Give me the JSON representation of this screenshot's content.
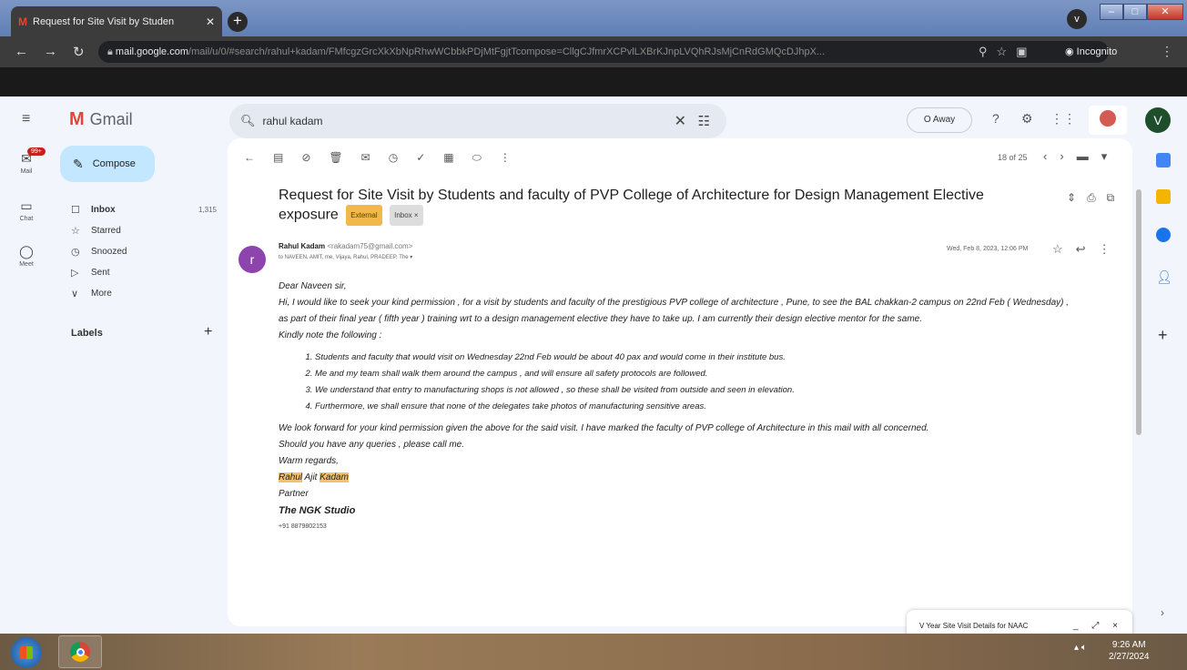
{
  "browser": {
    "tab_title": "Request for Site Visit by Studen",
    "tab_favicon": "gmail-icon",
    "url_host": "mail.google.com",
    "url_path": "/mail/u/0/#search/rahul+kadam/FMfcgzGrcXkXbNpRhwWCbbkPDjMtFgjtTcompose=CllgCJfmrXCPvlLXBrKJnpLVQhRJsMjCnRdGMQcDJhpX...",
    "incognito_label": "Incognito",
    "profile_menu_label": "v"
  },
  "gmail": {
    "app_name": "Gmail",
    "search_value": "rahul kadam",
    "status_label": "O Away",
    "avatar_letter": "V",
    "compose_label": "Compose",
    "nav": [
      {
        "icon": "inbox-icon",
        "glyph": "☐",
        "label": "Inbox",
        "count": "1,315"
      },
      {
        "icon": "star-icon",
        "glyph": "☆",
        "label": "Starred",
        "count": ""
      },
      {
        "icon": "clock-icon",
        "glyph": "◷",
        "label": "Snoozed",
        "count": ""
      },
      {
        "icon": "send-icon",
        "glyph": "▷",
        "label": "Sent",
        "count": ""
      },
      {
        "icon": "chevron-down-icon",
        "glyph": "∨",
        "label": "More",
        "count": ""
      }
    ],
    "labels_heading": "Labels",
    "rail": {
      "mail_label": "Mail",
      "mail_badge": "99+",
      "chat_label": "Chat",
      "meet_label": "Meet"
    },
    "pager_text": "18 of 25"
  },
  "email": {
    "subject": "Request for Site Visit by Students and faculty of PVP College of Architecture for Design Management Elective exposure",
    "tag_external": "External",
    "tag_inbox": "Inbox ×",
    "sender_initial": "r",
    "sender_name": "Rahul Kadam",
    "sender_email": "<rakadam75@gmail.com>",
    "recipients": "to NAVEEN, AMIT, me, Vijaya, Rahul, PRADEEP, The ▾",
    "date": "Wed, Feb 8, 2023, 12:06 PM",
    "greeting": "Dear Naveen sir,",
    "para1": "Hi, I would like to seek your kind permission , for a visit by students and faculty  of the prestigious PVP college of architecture , Pune, to see the BAL chakkan-2 campus on 22nd Feb ( Wednesday) , as part of their final year ( fifth year ) training wrt to a design management elective they have to take up. I am currently their design elective mentor for the same.",
    "note_intro": "Kindly note the following :",
    "points": [
      "Students and faculty that would visit on Wednesday 22nd Feb would be about 40 pax  and would come in their institute bus.",
      "Me and my team shall walk them around the campus , and will ensure all safety protocols are followed.",
      "We understand that entry to manufacturing shops is not allowed , so these shall be visited from outside and seen in elevation.",
      "Furthermore, we shall ensure that none of the delegates take photos of manufacturing sensitive areas."
    ],
    "para2": "We look forward for your kind permission given the above for the said visit. I have marked the faculty of PVP college of Architecture in this mail with all concerned.",
    "para3": "Should you have any queries , please call me.",
    "closing": "Warm regards,",
    "sig_first": "Rahul",
    "sig_middle": " Ajit ",
    "sig_last": "Kadam",
    "sig_role": "Partner",
    "sig_company": "The NGK Studio",
    "sig_phone": "+91 8879802153"
  },
  "draft_chip": {
    "title": "V Year Site Visit Details for NAAC",
    "controls": "_ ⤢ ×"
  },
  "taskbar": {
    "time": "9:26 AM",
    "date": "2/27/2024"
  },
  "colors": {
    "gmail_bg": "#f2f5fb",
    "compose_bg": "#c2e7ff",
    "highlight": "#f5c26b",
    "accent_red": "#ea4335"
  }
}
